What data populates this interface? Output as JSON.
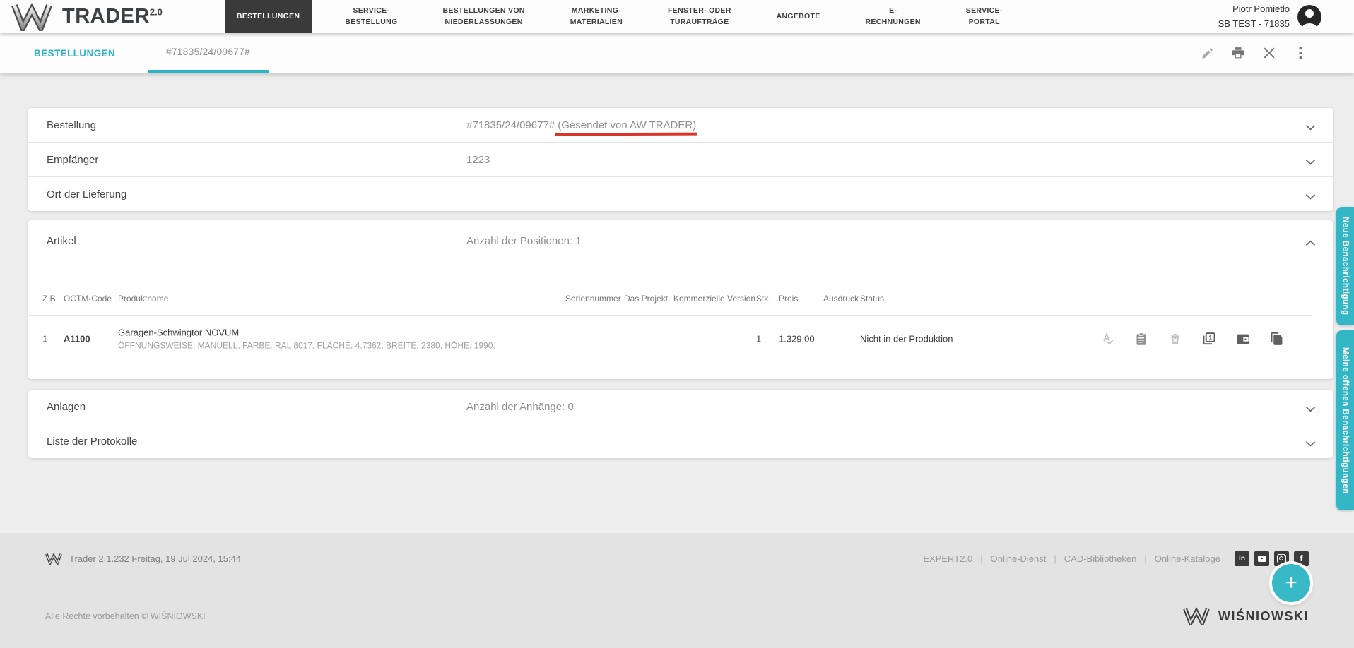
{
  "header": {
    "logo_text": "TRADER",
    "logo_sup": "2.0",
    "nav": [
      {
        "label": "BESTELLUNGEN",
        "active": true
      },
      {
        "label": "SERVICE-\nBESTELLUNG",
        "active": false
      },
      {
        "label": "BESTELLUNGEN VON\nNIEDERLASSUNGEN",
        "active": false
      },
      {
        "label": "MARKETING-\nMATERIALIEN",
        "active": false
      },
      {
        "label": "FENSTER- ODER\nTÜRAUFTRÄGE",
        "active": false
      },
      {
        "label": "ANGEBOTE",
        "active": false
      },
      {
        "label": "E-\nRECHNUNGEN",
        "active": false
      },
      {
        "label": "SERVICE-\nPORTAL",
        "active": false
      }
    ],
    "user": {
      "name": "Piotr Pomietło",
      "account": "SB TEST - 71835"
    }
  },
  "tabbar": {
    "tabs": [
      {
        "label": "BESTELLUNGEN",
        "active": false
      },
      {
        "label": "#71835/24/09677#",
        "active": true
      }
    ],
    "actions": [
      "edit-icon",
      "print-icon",
      "close-icon",
      "more-vert-icon"
    ]
  },
  "sections": {
    "bestellung": {
      "label": "Bestellung",
      "value": "#71835/24/09677# ",
      "note": "(Gesendet von AW TRADER)",
      "expanded": false
    },
    "empfaenger": {
      "label": "Empfänger",
      "value": "1223",
      "expanded": false
    },
    "ort": {
      "label": "Ort der Lieferung",
      "expanded": false
    },
    "artikel": {
      "label": "Artikel",
      "value": "Anzahl der Positionen: 1",
      "expanded": true
    },
    "anlagen": {
      "label": "Anlagen",
      "value": "Anzahl der Anhänge: 0",
      "expanded": false
    },
    "protokolle": {
      "label": "Liste der Protokolle",
      "expanded": false
    }
  },
  "table": {
    "columns": [
      "Z.B.",
      "OCTM-Code",
      "Produktname",
      "Seriennummer",
      "Das Projekt",
      "Kommerzielle Version",
      "Stk.",
      "Preis",
      "Ausdruck",
      "Status"
    ],
    "rows": [
      {
        "zb": "1",
        "octm": "A1100",
        "name": "Garagen-Schwingtor NOVUM",
        "desc": "ÖFFNUNGSWEISE: MANUELL, FARBE: RAL 8017, FLÄCHE: 4.7362, BREITE: 2380, HÖHE: 1990,",
        "serial": "",
        "project": "",
        "commercial": "",
        "qty": "1",
        "price": "1.329,00",
        "print": "",
        "status": "Nicht in der Produktion",
        "actions": [
          "spellcheck-icon",
          "clipboard-icon",
          "delete-icon",
          "filter-1-icon",
          "wallet-icon",
          "file-copy-icon"
        ]
      }
    ]
  },
  "side_tabs": [
    {
      "label": "Neue Benachrichtigung"
    },
    {
      "label": "Meine offenen Benachrichtigungen"
    }
  ],
  "footer": {
    "version": "Trader 2.1.232 Freitag, 19 Jul 2024, 15:44",
    "links": [
      "EXPERT2.0",
      "Online-Dienst",
      "CAD-Bibliotheken",
      "Online-Kataloge"
    ],
    "socials": [
      "linkedin-icon",
      "youtube-icon",
      "instagram-icon",
      "facebook-icon"
    ],
    "copyright": "Alle Rechte vorbehalten © WIŚNIOWSKI",
    "brand": "WIŚNIOWSKI",
    "fab_label": "+"
  },
  "colors": {
    "accent_teal": "#33b6c5",
    "annotation_red": "#da352a",
    "nav_active_bg": "#3a3a3a",
    "page_bg": "#ededed",
    "footer_bg": "#e3e3e3"
  }
}
